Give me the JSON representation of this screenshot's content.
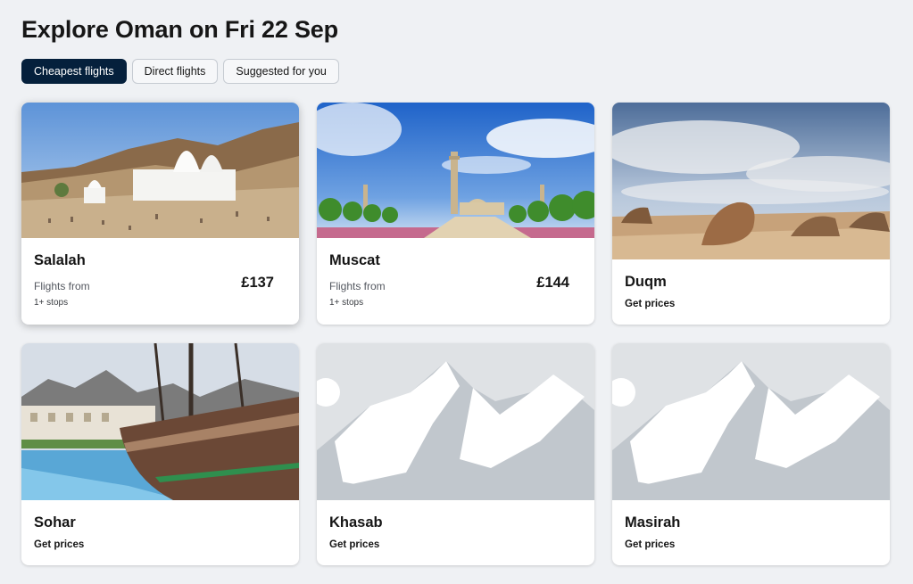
{
  "page": {
    "title": "Explore Oman on Fri 22 Sep"
  },
  "filters": [
    {
      "label": "Cheapest flights",
      "active": true
    },
    {
      "label": "Direct flights",
      "active": false
    },
    {
      "label": "Suggested for you",
      "active": false
    }
  ],
  "destinations": [
    {
      "city": "Salalah",
      "from_label": "Flights from",
      "price": "£137",
      "stops": "1+ stops",
      "image": "desert-shrine-photo"
    },
    {
      "city": "Muscat",
      "from_label": "Flights from",
      "price": "£144",
      "stops": "1+ stops",
      "image": "grand-mosque-photo"
    },
    {
      "city": "Duqm",
      "cta": "Get prices",
      "image": "rock-garden-photo"
    },
    {
      "city": "Sohar",
      "cta": "Get prices",
      "image": "dhow-ship-photo"
    },
    {
      "city": "Khasab",
      "cta": "Get prices",
      "image": "mountain-placeholder-icon"
    },
    {
      "city": "Masirah",
      "cta": "Get prices",
      "image": "mountain-placeholder-icon"
    }
  ],
  "colors": {
    "chip_active": "#05203c",
    "page_bg": "#eff1f4",
    "placeholder_bg": "#dfe2e5",
    "placeholder_shape": "#c1c7cd"
  }
}
